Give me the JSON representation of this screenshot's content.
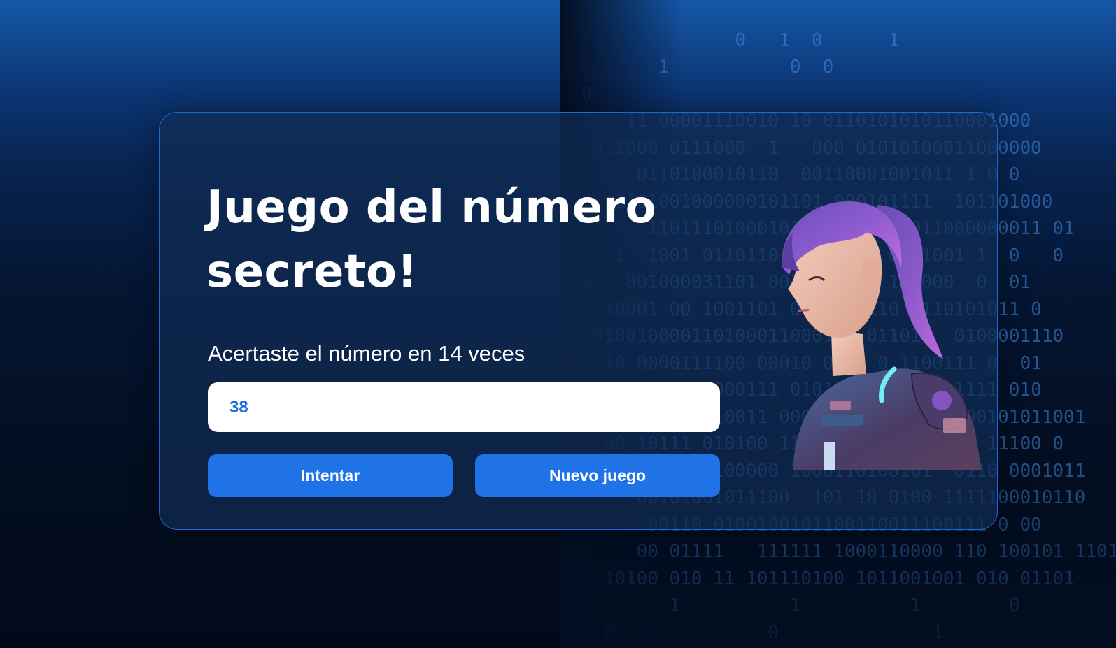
{
  "game": {
    "title": "Juego del número secreto!",
    "message": "Acertaste el número en 14 veces",
    "guess_value": "38",
    "try_button_label": "Intentar",
    "new_game_button_label": "Nuevo juego"
  },
  "theme": {
    "accent": "#1f73e6",
    "card_border": "#1a6ad6",
    "input_text": "#1d6fe0"
  },
  "icons": {
    "character": "astronaut-girl-illustration"
  }
}
